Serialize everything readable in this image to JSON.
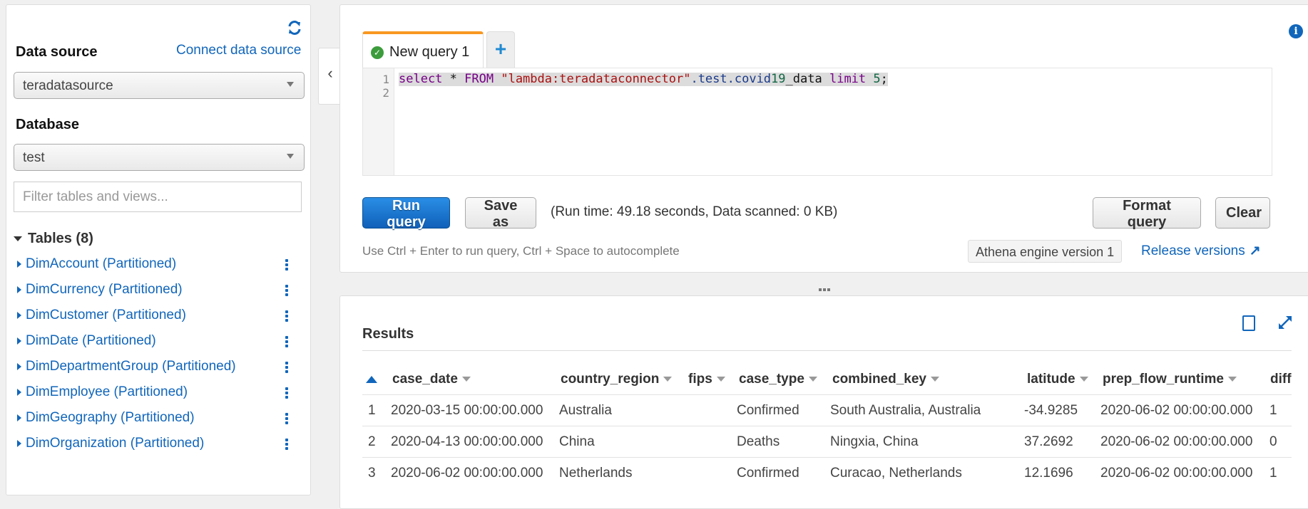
{
  "sidebar": {
    "data_source_label": "Data source",
    "connect_link": "Connect data source",
    "data_source_value": "teradatasource",
    "database_label": "Database",
    "database_value": "test",
    "filter_placeholder": "Filter tables and views...",
    "tables_header": "Tables (8)",
    "tables": [
      {
        "label": "DimAccount (Partitioned)"
      },
      {
        "label": "DimCurrency (Partitioned)"
      },
      {
        "label": "DimCustomer (Partitioned)"
      },
      {
        "label": "DimDate (Partitioned)"
      },
      {
        "label": "DimDepartmentGroup (Partitioned)"
      },
      {
        "label": "DimEmployee (Partitioned)"
      },
      {
        "label": "DimGeography (Partitioned)"
      },
      {
        "label": "DimOrganization (Partitioned)"
      }
    ]
  },
  "editor": {
    "tab_label": "New query 1",
    "tab_status": "success",
    "add_tab_label": "+",
    "line_numbers": [
      "1",
      "2"
    ],
    "query_tokens": {
      "t1": "select",
      "t2": " * ",
      "t3": "FROM",
      "t4": " ",
      "t5": "\"lambda:teradataconnector\"",
      "t6": ".test.covid",
      "t7": "19",
      "t8": "_data",
      "t9": " ",
      "t10": "limit",
      "t11": " ",
      "t12": "5",
      "t13": ";"
    },
    "query_text": "select * FROM \"lambda:teradataconnector\".test.covid19_data limit 5;",
    "run_button": "Run query",
    "save_button": "Save as",
    "run_info": "(Run time: 49.18 seconds, Data scanned: 0 KB)",
    "format_button": "Format query",
    "clear_button": "Clear",
    "hint": "Use Ctrl + Enter to run query, Ctrl + Space to autocomplete",
    "engine_version": "Athena engine version 1",
    "release_link": "Release versions",
    "collapse_glyph": "‹",
    "info_glyph": "i"
  },
  "results": {
    "title": "Results",
    "sort_column": "case_date",
    "sort_direction": "ascending",
    "columns": [
      "case_date",
      "country_region",
      "fips",
      "case_type",
      "combined_key",
      "latitude",
      "prep_flow_runtime",
      "diff"
    ],
    "rows": [
      {
        "n": "1",
        "case_date": "2020-03-15 00:00:00.000",
        "country_region": "Australia",
        "fips": "",
        "case_type": "Confirmed",
        "combined_key": "South Australia, Australia",
        "latitude": "-34.9285",
        "prep_flow_runtime": "2020-06-02 00:00:00.000",
        "diff": "1"
      },
      {
        "n": "2",
        "case_date": "2020-04-13 00:00:00.000",
        "country_region": "China",
        "fips": "",
        "case_type": "Deaths",
        "combined_key": "Ningxia, China",
        "latitude": "37.2692",
        "prep_flow_runtime": "2020-06-02 00:00:00.000",
        "diff": "0"
      },
      {
        "n": "3",
        "case_date": "2020-06-02 00:00:00.000",
        "country_region": "Netherlands",
        "fips": "",
        "case_type": "Confirmed",
        "combined_key": "Curacao, Netherlands",
        "latitude": "12.1696",
        "prep_flow_runtime": "2020-06-02 00:00:00.000",
        "diff": "1"
      }
    ]
  },
  "colors": {
    "accent": "#1166bb",
    "tab_active": "#f89820",
    "success": "#3c9c3c"
  }
}
